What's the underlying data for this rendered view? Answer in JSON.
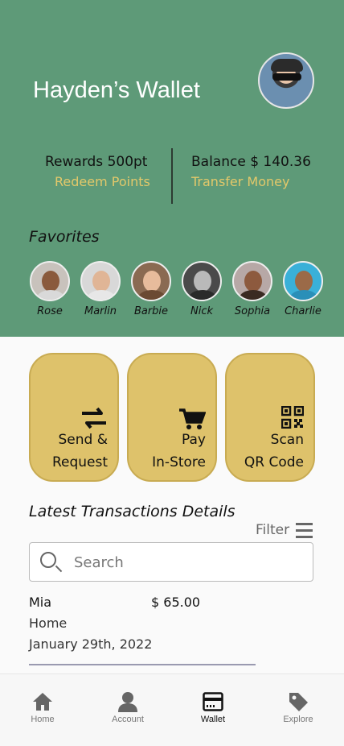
{
  "wallet": {
    "title": "Hayden’s Wallet",
    "rewards_label": "Rewards 500pt",
    "redeem_link": "Redeem Points",
    "balance_label": "Balance  $ 140.36",
    "transfer_link": "Transfer Money"
  },
  "favorites": {
    "title": "Favorites",
    "people": [
      {
        "name": "Rose"
      },
      {
        "name": "Marlin"
      },
      {
        "name": "Barbie"
      },
      {
        "name": "Nick"
      },
      {
        "name": "Sophia"
      },
      {
        "name": "Charlie"
      }
    ]
  },
  "actions": [
    {
      "line1": "Send &",
      "line2": "Request",
      "icon": "swap-arrows-icon"
    },
    {
      "line1": "Pay",
      "line2": "In-Store",
      "icon": "shopping-cart-icon"
    },
    {
      "line1": "Scan",
      "line2": "QR Code",
      "icon": "qr-code-icon"
    }
  ],
  "transactions": {
    "title": "Latest Transactions Details",
    "filter_label": "Filter",
    "search_placeholder": "Search",
    "items": [
      {
        "name": "Mia",
        "amount": "$ 65.00",
        "category": "Home",
        "date": "January  29th, 2022"
      }
    ]
  },
  "nav": {
    "items": [
      {
        "label": "Home",
        "icon": "home-icon"
      },
      {
        "label": "Account",
        "icon": "account-icon"
      },
      {
        "label": "Wallet",
        "icon": "wallet-card-icon"
      },
      {
        "label": "Explore",
        "icon": "tag-icon"
      }
    ],
    "active": "Wallet"
  },
  "colors": {
    "header_bg": "#5e9a78",
    "accent_link": "#e3c86a",
    "action_tile": "#dec26b"
  }
}
